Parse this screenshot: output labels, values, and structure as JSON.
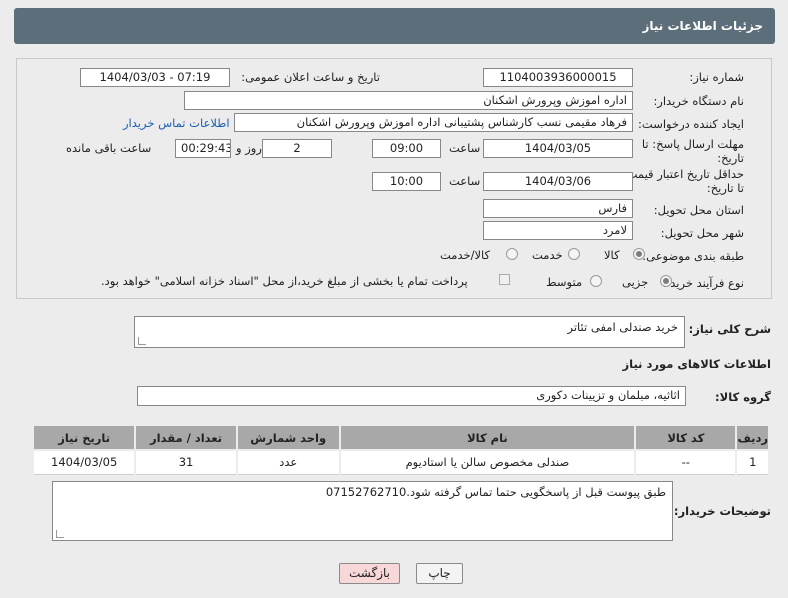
{
  "header": {
    "title": "جزئیات اطلاعات نیاز"
  },
  "form": {
    "need_number": {
      "label": "شماره نیاز:",
      "value": "1104003936000015"
    },
    "announce_datetime": {
      "label": "تاریخ و ساعت اعلان عمومی:",
      "value": "1404/03/03 - 07:19"
    },
    "buyer_org": {
      "label": "نام دستگاه خریدار:",
      "value": "اداره اموزش وپرورش اشکنان"
    },
    "requester": {
      "label": "ایجاد کننده درخواست:",
      "value": "فرهاد مقیمی نسب کارشناس پشتیبانی اداره اموزش وپرورش اشکنان",
      "contact_link": "اطلاعات تماس خریدار"
    },
    "reply_deadline": {
      "label_line1": "مهلت ارسال پاسخ: تا",
      "label_line2": "تاریخ:",
      "date": "1404/03/05",
      "time_label": "ساعت",
      "time": "09:00",
      "days": "2",
      "days_label": "روز و",
      "remaining": "00:29:43",
      "remaining_label": "ساعت باقی مانده"
    },
    "price_validity": {
      "label_line1": "حداقل تاریخ اعتبار قیمت:",
      "label_line2": "تا تاریخ:",
      "date": "1404/03/06",
      "time_label": "ساعت",
      "time": "10:00"
    },
    "delivery_province": {
      "label": "استان محل تحویل:",
      "value": "فارس"
    },
    "delivery_city": {
      "label": "شهر محل تحویل:",
      "value": "لامرد"
    },
    "category": {
      "label": "طبقه بندی موضوعی:",
      "options": [
        "کالا",
        "خدمت",
        "کالا/خدمت"
      ],
      "selected": "کالا"
    },
    "purchase_process": {
      "label": "نوع فرآیند خرید :",
      "options": [
        "جزیی",
        "متوسط"
      ],
      "selected": "جزیی",
      "note": "پرداخت تمام یا بخشی از مبلغ خرید،از محل \"اسناد خزانه اسلامی\" خواهد بود."
    }
  },
  "description": {
    "label": "شرح کلی نیاز:",
    "value": "خرید صندلی امفی تئاتر"
  },
  "goods_section": {
    "title": "اطلاعات کالاهای مورد نیاز",
    "group_label": "گروه کالا:",
    "group_value": "اثاثیه، مبلمان و تزیینات دکوری"
  },
  "table": {
    "headers": [
      "ردیف",
      "کد کالا",
      "نام کالا",
      "واحد شمارش",
      "تعداد / مقدار",
      "تاریخ نیاز"
    ],
    "rows": [
      [
        "1",
        "--",
        "صندلی مخصوص سالن یا استادیوم",
        "عدد",
        "31",
        "1404/03/05"
      ]
    ]
  },
  "buyer_notes": {
    "label": "توضیحات خریدار:",
    "value": "طبق پیوست قبل از پاسخگویی حتما تماس گرفته شود.07152762710"
  },
  "buttons": {
    "print": "چاپ",
    "back": "بازگشت"
  },
  "watermark": "AriaTender.neT",
  "colors": {
    "header_bg": "#5c6e7a",
    "link": "#1a5fb4",
    "back_button_bg": "#f7d7d7",
    "table_header_bg": "#a8a8a8"
  }
}
